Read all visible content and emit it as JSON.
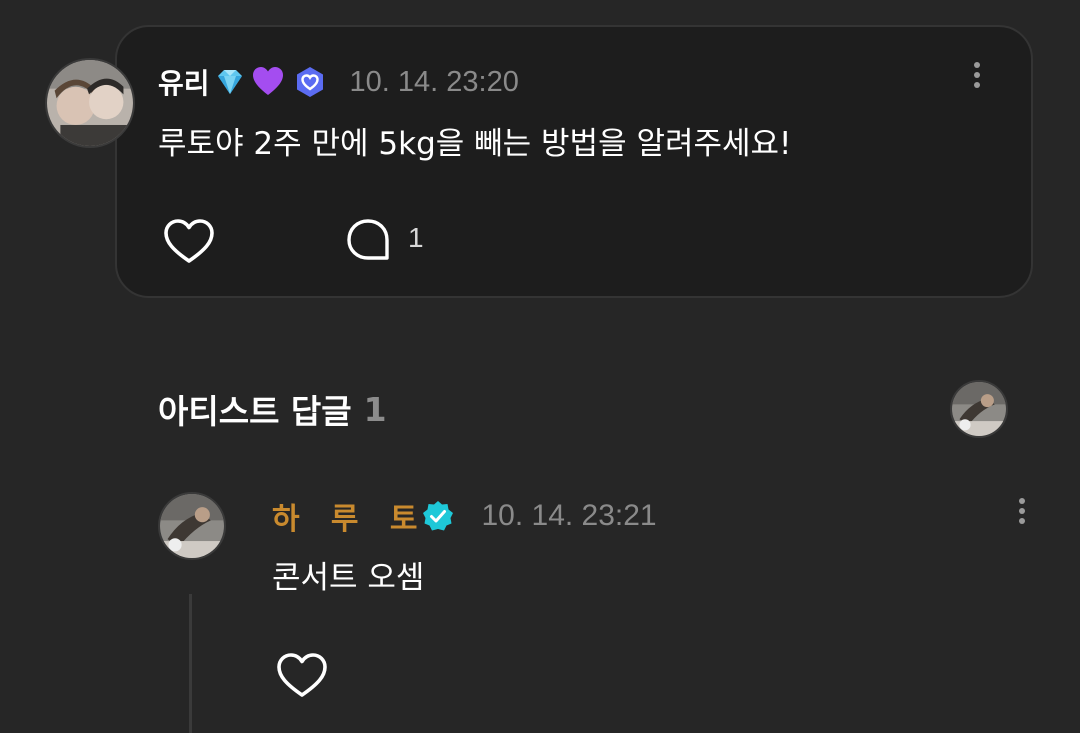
{
  "post": {
    "author_name": "유리",
    "author_badges": [
      "gem-emoji",
      "purple-heart-emoji",
      "fan-badge-icon"
    ],
    "timestamp": "10. 14. 23:20",
    "text": "루토야 2주 만에 5kg을 빼는 방법을 알려주세요!",
    "comment_count": "1",
    "icons": {
      "more": "more-vertical-icon",
      "like": "heart-outline-icon",
      "comment": "speech-bubble-icon"
    }
  },
  "artist_replies": {
    "title": "아티스트 답글",
    "count": "1"
  },
  "reply": {
    "author_name": "하   루   토",
    "timestamp": "10. 14. 23:21",
    "text": "콘서트 오셈",
    "icons": {
      "verified": "verified-badge-icon",
      "more": "more-vertical-icon",
      "like": "heart-outline-icon"
    }
  },
  "colors": {
    "background": "#262626",
    "card": "#1d1d1d",
    "artist_name": "#c98a2e",
    "verified": "#1ec8d8",
    "muted_text": "#8a8a8a"
  }
}
